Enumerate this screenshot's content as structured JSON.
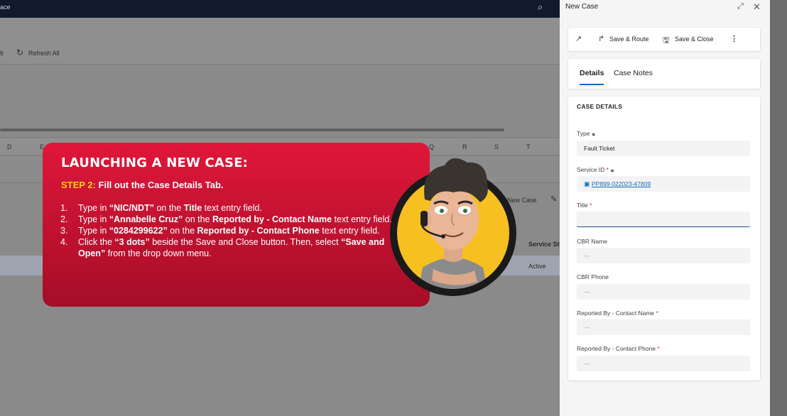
{
  "bg": {
    "topbar_text": "ace",
    "cmd_left": "lt",
    "refresh_label": "Refresh All",
    "columns": [
      "D",
      "E",
      "Q",
      "R",
      "S",
      "T"
    ],
    "new_case": "New Case",
    "service_header": "Service St",
    "row_status": "Active"
  },
  "overlay": {
    "title": "LAUNCHING A NEW CASE:",
    "step_label": "STEP 2:",
    "step_text": "Fill out the Case Details Tab.",
    "items": [
      {
        "num": "1.",
        "parts": [
          [
            "Type in ",
            false
          ],
          [
            "“NIC/NDT”",
            true
          ],
          [
            " on the ",
            false
          ],
          [
            "Title",
            true
          ],
          [
            " text entry field.",
            false
          ]
        ]
      },
      {
        "num": "2.",
        "parts": [
          [
            "Type in ",
            false
          ],
          [
            "“Annabelle Cruz”",
            true
          ],
          [
            " on the ",
            false
          ],
          [
            "Reported by - Contact Name",
            true
          ],
          [
            " text entry field.",
            false
          ]
        ]
      },
      {
        "num": "3.",
        "parts": [
          [
            "Type in ",
            false
          ],
          [
            "“0284299622”",
            true
          ],
          [
            " on the ",
            false
          ],
          [
            "Reported by - Contact Phone",
            true
          ],
          [
            " text entry field.",
            false
          ]
        ]
      },
      {
        "num": "4.",
        "parts": [
          [
            "Click the ",
            false
          ],
          [
            "“3 dots”",
            true
          ],
          [
            " beside the Save and Close button. Then, select ",
            false
          ],
          [
            "“Save and Open”",
            true
          ],
          [
            " from the drop down menu.",
            false
          ]
        ]
      }
    ]
  },
  "panel": {
    "title": "New Case",
    "toolbar": {
      "save_route": "Save & Route",
      "save_close": "Save & Close"
    },
    "tabs": [
      "Details",
      "Case Notes"
    ],
    "section_title": "CASE DETAILS",
    "fields": {
      "type_label": "Type",
      "type_value": "Fault Ticket",
      "service_label": "Service ID",
      "service_value": "PP899-022023-47809",
      "title_label": "Title",
      "title_value": "",
      "cbr_name_label": "CBR Name",
      "cbr_name_value": "---",
      "cbr_phone_label": "CBR Phone",
      "cbr_phone_value": "---",
      "contact_name_label": "Reported By - Contact Name",
      "contact_name_value": "---",
      "contact_phone_label": "Reported By - Contact Phone",
      "contact_phone_value": "---"
    }
  },
  "colors": {
    "overlay_top": "#e0173a",
    "overlay_bottom": "#a50d27",
    "step_highlight": "#ffd21a",
    "accent": "#0f6cbd",
    "topbar": "#101a2c"
  },
  "icons": [
    "search-icon",
    "refresh-icon",
    "pencil-icon",
    "expand-icon",
    "close-icon",
    "popout-icon",
    "route-icon",
    "save-icon",
    "more-icon",
    "lock-icon",
    "record-icon"
  ]
}
